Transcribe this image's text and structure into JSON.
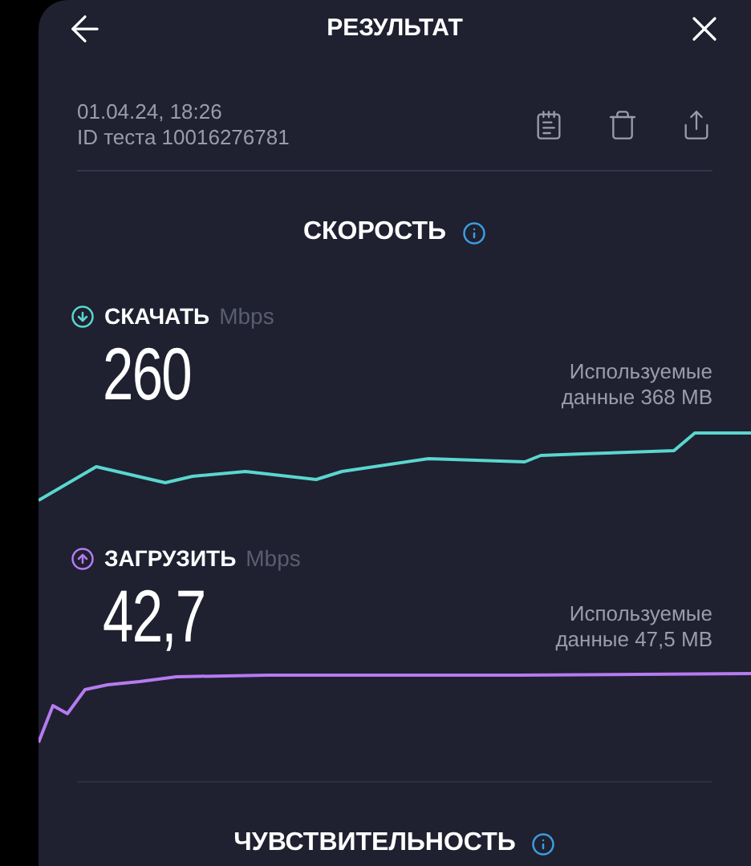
{
  "header": {
    "title": "РЕЗУЛЬТАТ"
  },
  "test": {
    "datetime": "01.04.24, 18:26",
    "id": "ID теста 10016276781"
  },
  "speed_section": {
    "title": "СКОРОСТЬ"
  },
  "measurements": [
    {
      "kind": "download",
      "label": "СКАЧАТЬ",
      "unit": "Mbps",
      "value": "260",
      "data_used": "Используемые данные 368 MB",
      "color": "#5ad6cf"
    },
    {
      "kind": "upload",
      "label": "ЗАГРУЗИТЬ",
      "unit": "Mbps",
      "value": "42,7",
      "data_used": "Используемые данные 47,5 MB",
      "color": "#b57bf0"
    }
  ],
  "sensitivity_section": {
    "title": "ЧУВСТВИТЕЛЬНОСТЬ"
  }
}
